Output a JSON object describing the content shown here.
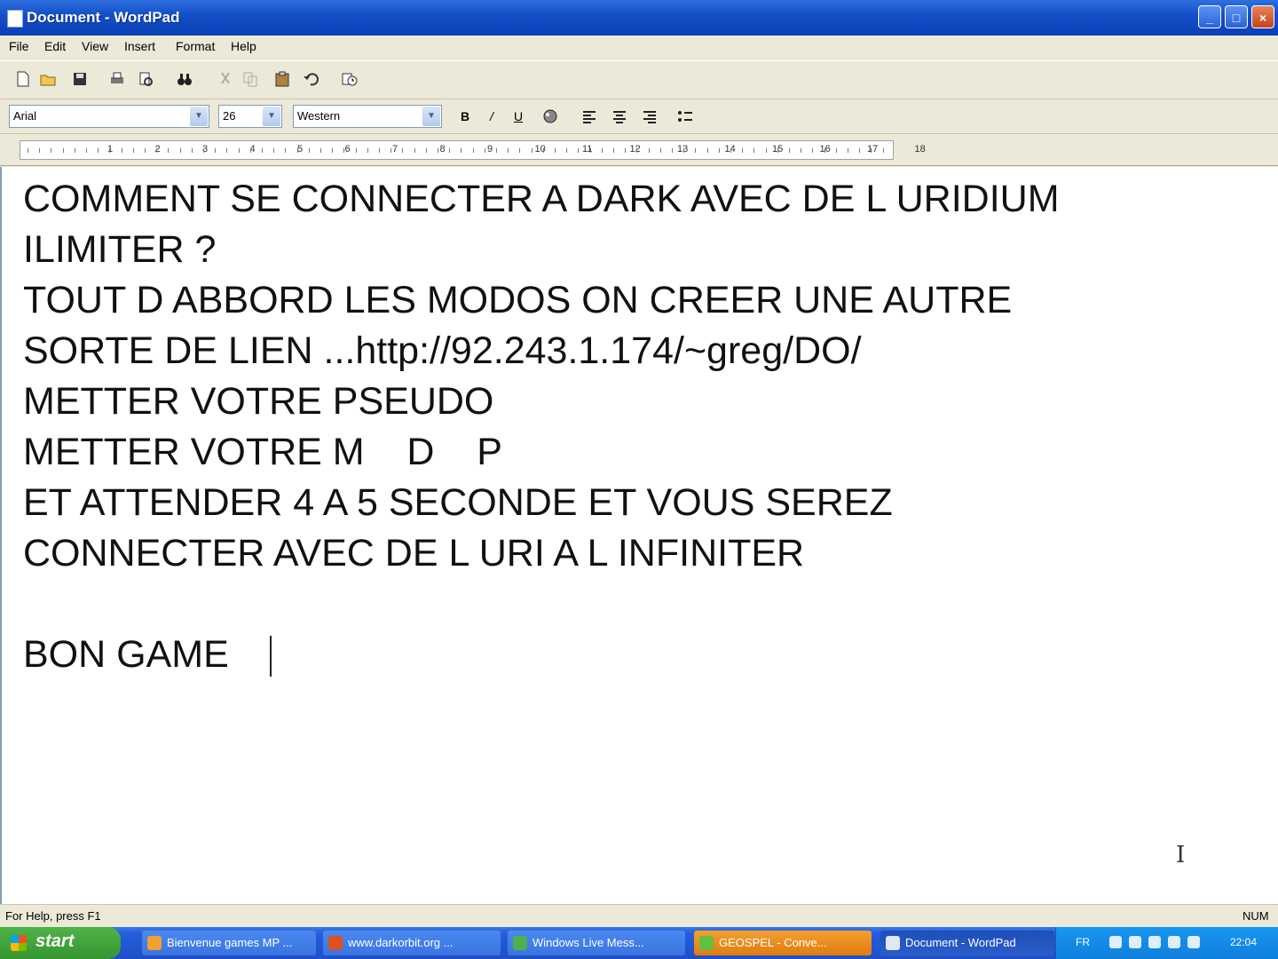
{
  "window": {
    "title": "Document - WordPad"
  },
  "menu": [
    "File",
    "Edit",
    "View",
    "Insert",
    "Format",
    "Help"
  ],
  "format": {
    "font": "Arial",
    "size": "26",
    "script": "Western"
  },
  "ruler_numbers": [
    "1",
    "2",
    "3",
    "4",
    "5",
    "6",
    "7",
    "8",
    "9",
    "10",
    "11",
    "12",
    "13",
    "14",
    "15",
    "16",
    "17",
    "18"
  ],
  "document": {
    "lines": [
      "COMMENT SE CONNECTER A DARK AVEC DE L URIDIUM",
      "ILIMITER ?",
      "TOUT D ABBORD LES MODOS ON CREER UNE AUTRE",
      "SORTE DE LIEN ...http://92.243.1.174/~greg/DO/",
      "METTER VOTRE PSEUDO",
      "METTER VOTRE M    D    P",
      "ET ATTENDER 4 A 5 SECONDE ET VOUS SEREZ",
      "CONNECTER AVEC DE L URI A L INFINITER",
      "",
      "BON GAME"
    ]
  },
  "status": {
    "help": "For Help, press F1",
    "num": "NUM"
  },
  "taskbar": {
    "start_label": "start",
    "tasks": [
      "Bienvenue games MP ...",
      "www.darkorbit.org ...",
      "Windows Live Mess...",
      "GEOSPEL - Conve...",
      "Document - WordPad"
    ],
    "tray_lang": "FR",
    "clock": "22:04"
  },
  "colors": {
    "title_blue": "#1450c8",
    "taskbar_blue": "#245edb",
    "start_green": "#35952f",
    "tray_blue": "#0f7fdc"
  }
}
